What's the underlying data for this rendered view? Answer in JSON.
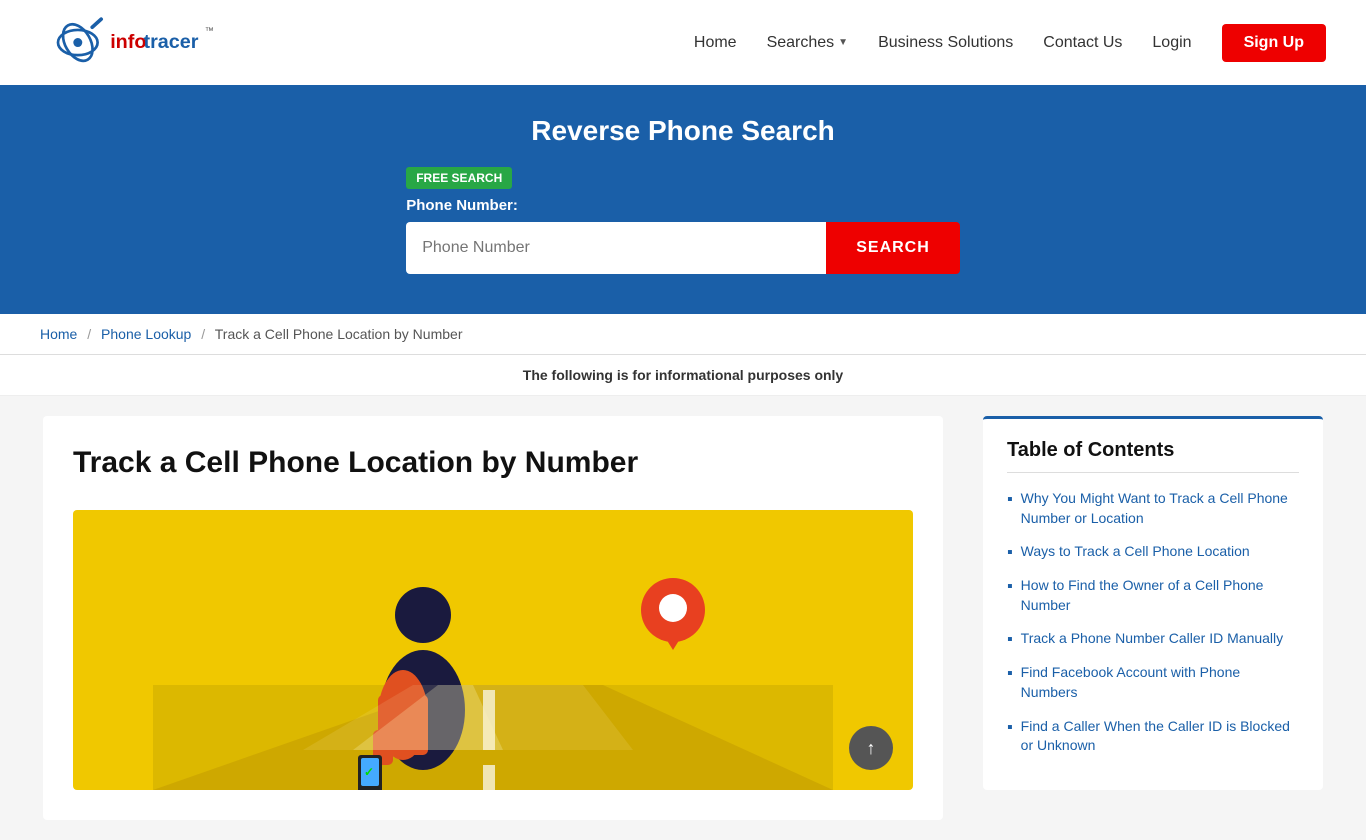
{
  "header": {
    "logo_alt": "InfoTracer",
    "nav": {
      "home": "Home",
      "searches": "Searches",
      "business": "Business Solutions",
      "contact": "Contact Us",
      "login": "Login",
      "signup": "Sign Up"
    }
  },
  "hero": {
    "title": "Reverse Phone Search",
    "badge": "FREE SEARCH",
    "phone_label": "Phone Number:",
    "phone_placeholder": "Phone Number",
    "search_button": "SEARCH"
  },
  "breadcrumb": {
    "home": "Home",
    "phone_lookup": "Phone Lookup",
    "current": "Track a Cell Phone Location by Number"
  },
  "info_bar": {
    "text": "The following is for informational purposes only"
  },
  "article": {
    "title": "Track a Cell Phone Location by Number"
  },
  "toc": {
    "title": "Table of Contents",
    "items": [
      {
        "label": "Why You Might Want to Track a Cell Phone Number or Location"
      },
      {
        "label": "Ways to Track a Cell Phone Location"
      },
      {
        "label": "How to Find the Owner of a Cell Phone Number"
      },
      {
        "label": "Track a Phone Number Caller ID Manually"
      },
      {
        "label": "Find Facebook Account with Phone Numbers"
      },
      {
        "label": "Find a Caller When the Caller ID is Blocked or Unknown"
      }
    ]
  },
  "scroll_up_label": "↑"
}
